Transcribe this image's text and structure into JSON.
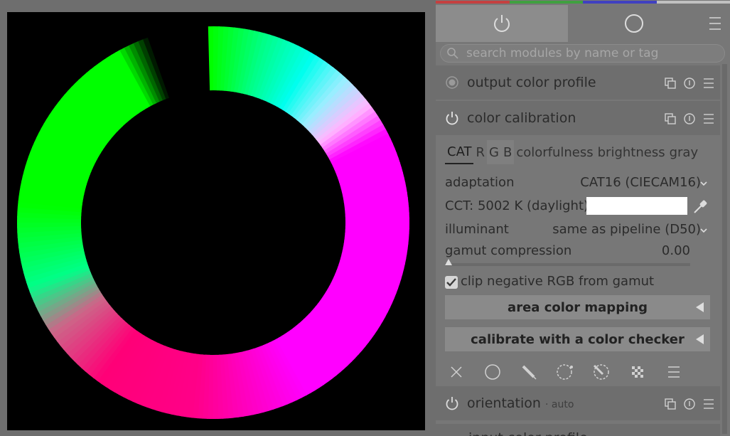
{
  "colors": {
    "panel_bg": "#777777",
    "module_header_bg": "#6e6e6e",
    "active_tab_bg": "#8c8c8c",
    "button_bg": "#8a8a8a",
    "icon_color": "#d0d0d0",
    "swatch": "#ffffff",
    "strip_colors": [
      "#c44040",
      "#40a040",
      "#4040c0",
      "#c0c0c0"
    ]
  },
  "tabs": [
    {
      "icon": "power-icon"
    },
    {
      "icon": "circle-icon"
    },
    {
      "icon": "hamburger-menu-icon"
    }
  ],
  "search": {
    "placeholder": "search modules by name or tag"
  },
  "modules": {
    "output_color_profile": {
      "title": "output color profile"
    },
    "color_calibration": {
      "title": "color calibration"
    },
    "orientation": {
      "title": "orientation",
      "sub": "· auto"
    },
    "next_partial": {
      "title": "input color profile"
    }
  },
  "calibration": {
    "subtabs": [
      "CAT",
      "R",
      "G",
      "B",
      "colorfulness",
      "brightness",
      "gray"
    ],
    "adaptation_label": "adaptation",
    "adaptation_value": "CAT16 (CIECAM16)",
    "cct_label": "CCT: 5002 K (daylight)",
    "illuminant_label": "illuminant",
    "illuminant_value": "same as pipeline (D50)",
    "gamut_label": "gamut compression",
    "gamut_value": "0.00",
    "gamut_level": 0.0,
    "clip_label": "clip negative RGB from gamut",
    "clip_checked": true,
    "area_button": "area color mapping",
    "checker_button": "calibrate with a color checker"
  },
  "toolbar_icons": [
    "close-icon",
    "circle-mask-icon",
    "pencil-icon",
    "parametric-mask-icon",
    "drawn-parametric-icon",
    "raster-mask-icon",
    "menu-icon"
  ]
}
